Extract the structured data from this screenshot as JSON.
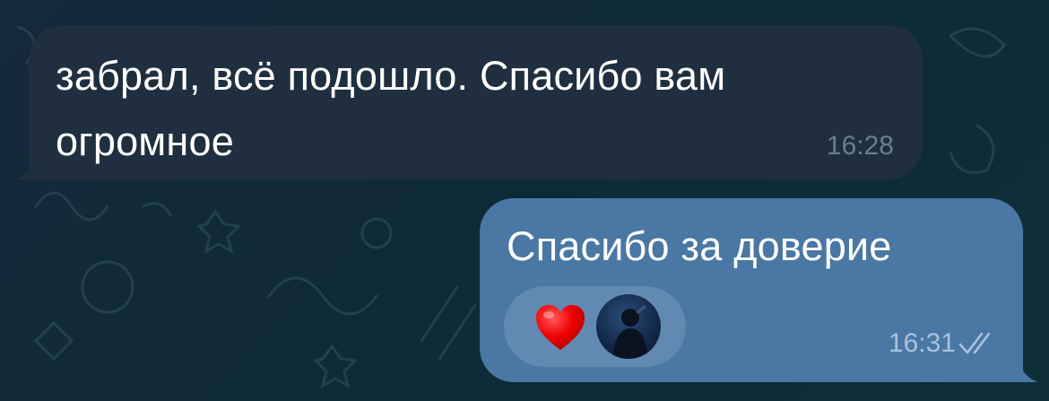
{
  "messages": {
    "incoming": {
      "text": "забрал, всё подошло. Спасибо вам огромное",
      "time": "16:28"
    },
    "outgoing": {
      "text": "Спасибо за доверие",
      "time": "16:31",
      "status": "read"
    }
  },
  "reactions": [
    {
      "emoji": "heart-emoji",
      "reactor": "user-avatar"
    }
  ],
  "colors": {
    "incoming_bubble": "#1f2f3f",
    "outgoing_bubble": "#4a77a3",
    "reaction_pill": "#6189b2",
    "heart": "#ff0000"
  }
}
